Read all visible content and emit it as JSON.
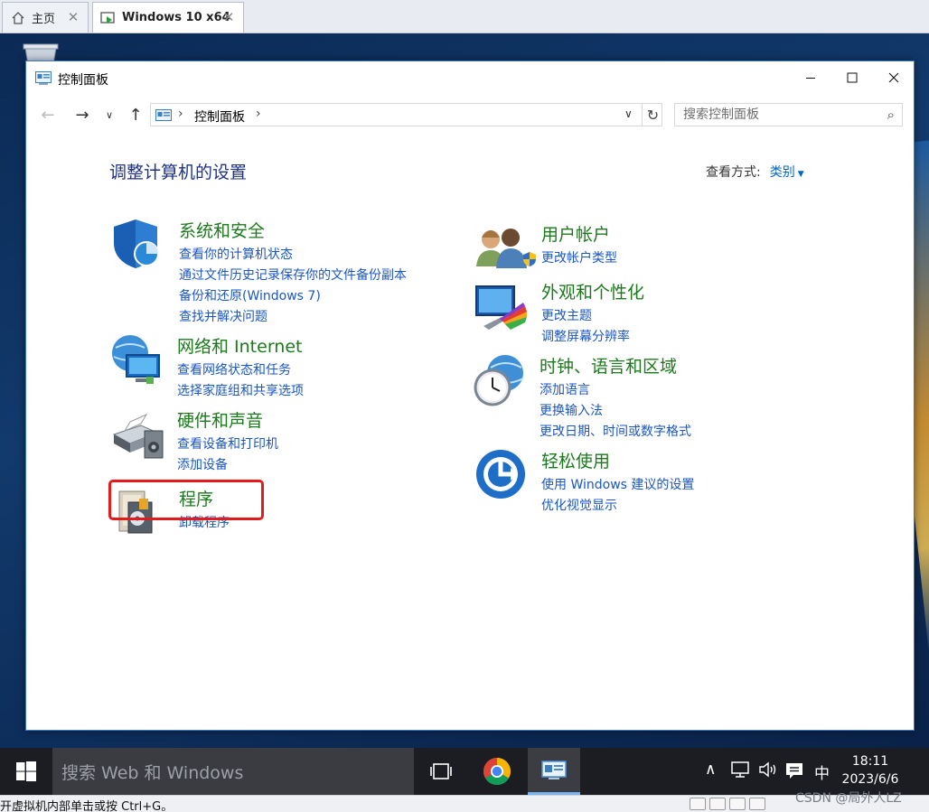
{
  "vm_tabs": [
    {
      "label": "主页",
      "icon": "home-icon"
    },
    {
      "label": "Windows 10 x64",
      "icon": "vm-running-icon"
    }
  ],
  "window": {
    "title": "控制面板",
    "controls": {
      "minimize": "minimize-icon",
      "maximize": "maximize-icon",
      "close": "close-icon"
    }
  },
  "address_bar": {
    "crumb": "控制面板",
    "search_placeholder": "搜索控制面板"
  },
  "main": {
    "title": "调整计算机的设置",
    "view_by_label": "查看方式:",
    "view_by_value": "类别"
  },
  "categories_left": [
    {
      "title": "系统和安全",
      "icon": "shield-icon",
      "links": [
        "查看你的计算机状态",
        "通过文件历史记录保存你的文件备份副本",
        "备份和还原(Windows 7)",
        "查找并解决问题"
      ]
    },
    {
      "title": "网络和 Internet",
      "icon": "network-icon",
      "links": [
        "查看网络状态和任务",
        "选择家庭组和共享选项"
      ]
    },
    {
      "title": "硬件和声音",
      "icon": "printer-icon",
      "links": [
        "查看设备和打印机",
        "添加设备"
      ]
    },
    {
      "title": "程序",
      "icon": "programs-icon",
      "links": [
        "卸载程序"
      ]
    }
  ],
  "categories_right": [
    {
      "title": "用户帐户",
      "icon": "users-icon",
      "links": [
        "更改帐户类型"
      ]
    },
    {
      "title": "外观和个性化",
      "icon": "appearance-icon",
      "links": [
        "更改主题",
        "调整屏幕分辨率"
      ]
    },
    {
      "title": "时钟、语言和区域",
      "icon": "clock-globe-icon",
      "links": [
        "添加语言",
        "更换输入法",
        "更改日期、时间或数字格式"
      ]
    },
    {
      "title": "轻松使用",
      "icon": "ease-of-access-icon",
      "links": [
        "使用 Windows 建议的设置",
        "优化视觉显示"
      ]
    }
  ],
  "taskbar": {
    "search_text": "搜索 Web 和 Windows",
    "ime": "中",
    "time": "18:11",
    "date": "2023/6/6"
  },
  "statusbar": {
    "hint": "开虚拟机内部单击或按 Ctrl+G。",
    "watermark": "CSDN @局外人LZ"
  },
  "colors": {
    "category_title": "#1c7a1c",
    "link": "#1a56c4",
    "page_title": "#1e3287",
    "highlight": "#e41b1b"
  }
}
